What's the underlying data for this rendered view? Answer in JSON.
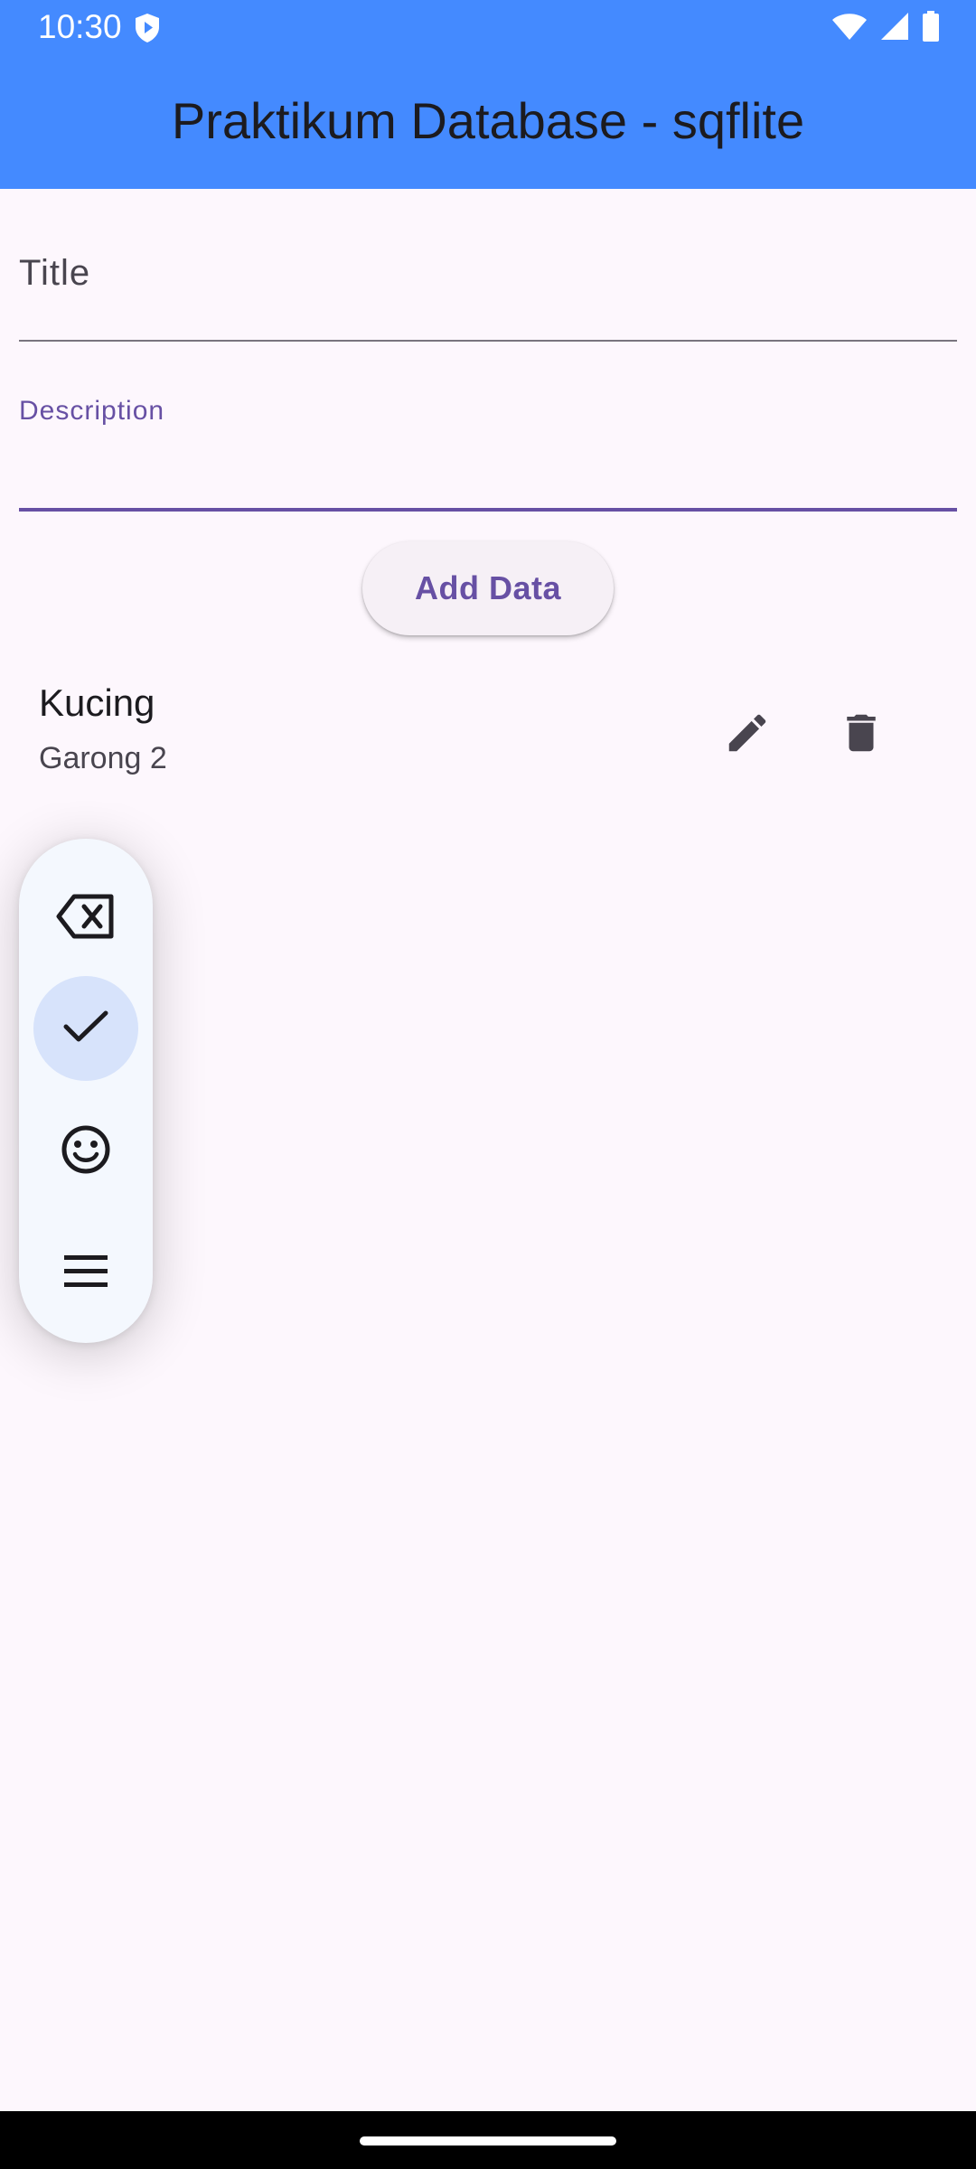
{
  "status_bar": {
    "time": "10:30",
    "icons": [
      "shield-play-icon",
      "wifi-icon",
      "cellular-signal-icon",
      "battery-icon"
    ]
  },
  "appbar": {
    "title": "Praktikum Database - sqflite",
    "background": "#448aff"
  },
  "form": {
    "title_label": "Title",
    "title_value": "",
    "description_label": "Description",
    "description_value": "",
    "add_button_label": "Add Data"
  },
  "items": [
    {
      "title": "Kucing",
      "subtitle": "Garong 2",
      "actions": [
        "edit-icon",
        "delete-icon"
      ]
    }
  ],
  "keyboard_toolbar": {
    "buttons": [
      "backspace-icon",
      "check-icon",
      "emoji-icon",
      "menu-icon"
    ],
    "active": "check-icon"
  },
  "colors": {
    "accent": "#6750a4",
    "background": "#fdf7fd"
  }
}
